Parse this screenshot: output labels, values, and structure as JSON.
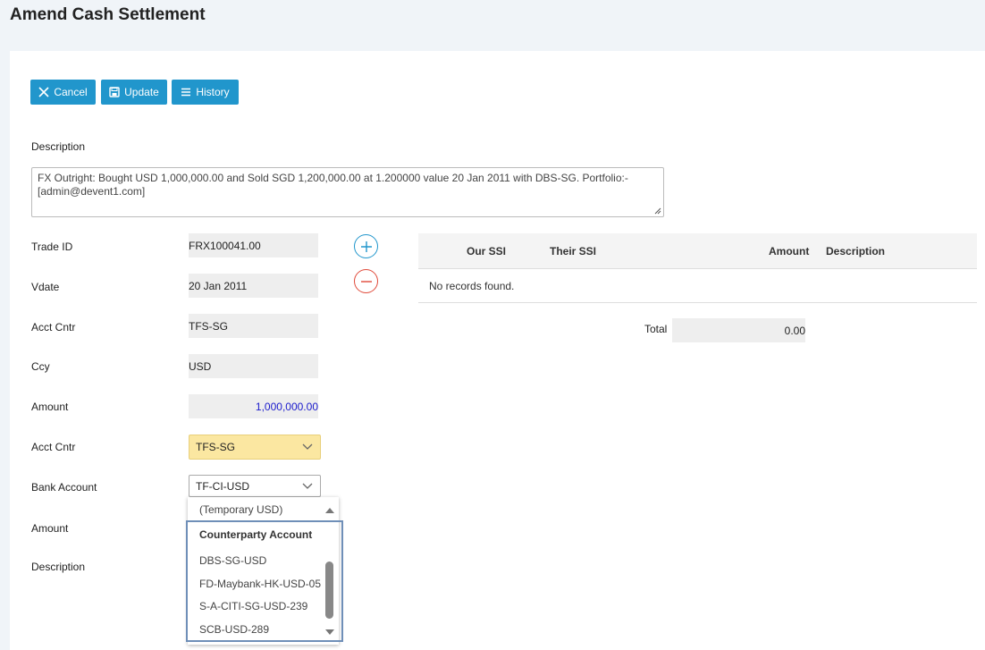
{
  "page": {
    "title": "Amend Cash Settlement"
  },
  "toolbar": {
    "cancel_label": "Cancel",
    "update_label": "Update",
    "history_label": "History"
  },
  "description": {
    "label": "Description",
    "value": "FX Outright: Bought USD 1,000,000.00 and Sold SGD 1,200,000.00 at 1.200000 value 20 Jan 2011 with DBS-SG. Portfolio:-[admin@devent1.com]"
  },
  "fields": {
    "trade_id": {
      "label": "Trade ID",
      "value": "FRX100041.00"
    },
    "vdate": {
      "label": "Vdate",
      "value": "20 Jan 2011"
    },
    "acct_cntr": {
      "label": "Acct Cntr",
      "value": "TFS-SG"
    },
    "ccy": {
      "label": "Ccy",
      "value": "USD"
    },
    "amount": {
      "label": "Amount",
      "value": "1,000,000.00"
    },
    "acct_cntr_select": {
      "label": "Acct Cntr",
      "value": "TFS-SG"
    },
    "bank_account": {
      "label": "Bank Account",
      "value": "TF-CI-USD"
    },
    "amount2": {
      "label": "Amount"
    },
    "description2": {
      "label": "Description"
    }
  },
  "table": {
    "headers": [
      "Our SSI",
      "Their SSI",
      "Amount",
      "Description"
    ],
    "empty_message": "No records found.",
    "total_label": "Total",
    "total_value": "0.00"
  },
  "dropdown": {
    "top_item": "(Temporary USD)",
    "group_label": "Counterparty Account",
    "items": [
      "DBS-SG-USD",
      "FD-Maybank-HK-USD-05",
      "S-A-CITI-SG-USD-239",
      "SCB-USD-289"
    ]
  },
  "colors": {
    "primary": "#2196cc",
    "add": "#2196cc",
    "remove": "#e04a3a",
    "select_highlight": "#fbe7a1",
    "amount_text": "#1a1acc"
  }
}
